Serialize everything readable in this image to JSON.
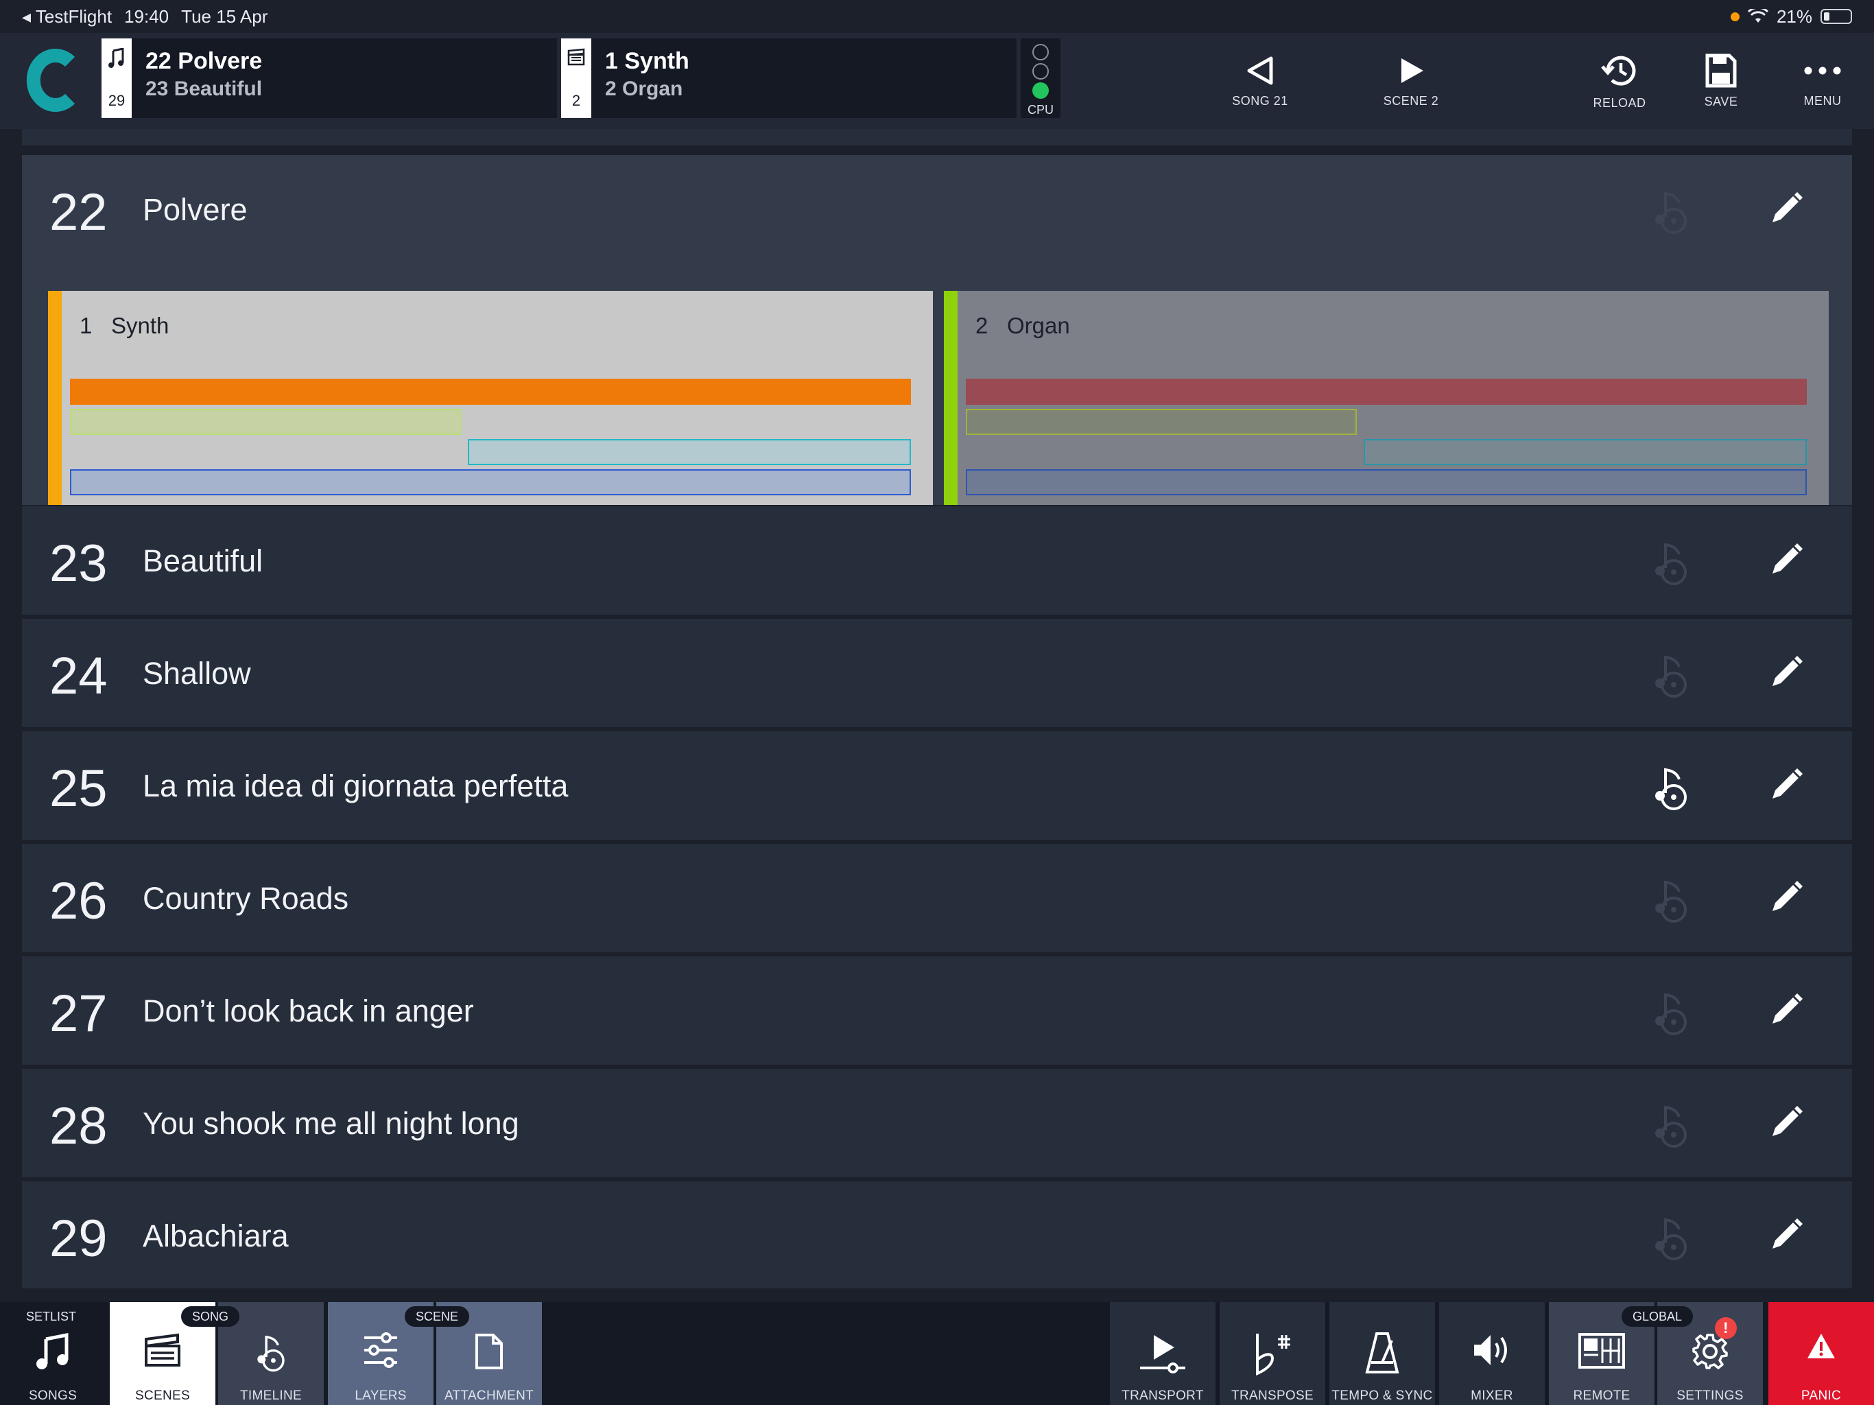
{
  "status_bar": {
    "back_app": "TestFlight",
    "time": "19:40",
    "date": "Tue 15 Apr",
    "battery": "21%"
  },
  "header": {
    "song_card": {
      "count": "29",
      "current": "22 Polvere",
      "next": "23 Beautiful"
    },
    "scene_card": {
      "count": "2",
      "current": "1 Synth",
      "next": "2 Organ"
    },
    "cpu_label": "CPU",
    "buttons": {
      "prev_song": "SONG 21",
      "next_scene": "SCENE 2",
      "reload": "RELOAD",
      "save": "SAVE",
      "menu": "MENU"
    }
  },
  "songs": [
    {
      "number": "22",
      "title": "Polvere",
      "attachment_active": false
    },
    {
      "number": "23",
      "title": "Beautiful",
      "attachment_active": false
    },
    {
      "number": "24",
      "title": "Shallow",
      "attachment_active": false
    },
    {
      "number": "25",
      "title": "La mia idea di giornata perfetta",
      "attachment_active": true
    },
    {
      "number": "26",
      "title": "Country Roads",
      "attachment_active": false
    },
    {
      "number": "27",
      "title": "Don’t look back in anger",
      "attachment_active": false
    },
    {
      "number": "28",
      "title": "You shook me all night long",
      "attachment_active": false
    },
    {
      "number": "29",
      "title": "Albachiara",
      "attachment_active": false
    }
  ],
  "scenes": [
    {
      "number": "1",
      "name": "Synth",
      "color": "#f5a70b",
      "selected": true
    },
    {
      "number": "2",
      "name": "Organ",
      "color": "#8fd10a",
      "selected": false
    }
  ],
  "footer": {
    "groups": {
      "setlist": "SETLIST",
      "song": "SONG",
      "scene": "SCENE",
      "global": "GLOBAL"
    },
    "buttons": {
      "songs": "SONGS",
      "scenes": "SCENES",
      "timeline": "TIMELINE",
      "layers": "LAYERS",
      "attachment": "ATTACHMENT",
      "transport": "TRANSPORT",
      "transpose": "TRANSPOSE",
      "tempo_sync": "TEMPO & SYNC",
      "mixer": "MIXER",
      "remote": "REMOTE",
      "settings": "SETTINGS",
      "panic": "PANIC"
    },
    "settings_badge": "!"
  },
  "colors": {
    "accent_teal": "#16a3a8",
    "panic_red": "#e0142b"
  }
}
